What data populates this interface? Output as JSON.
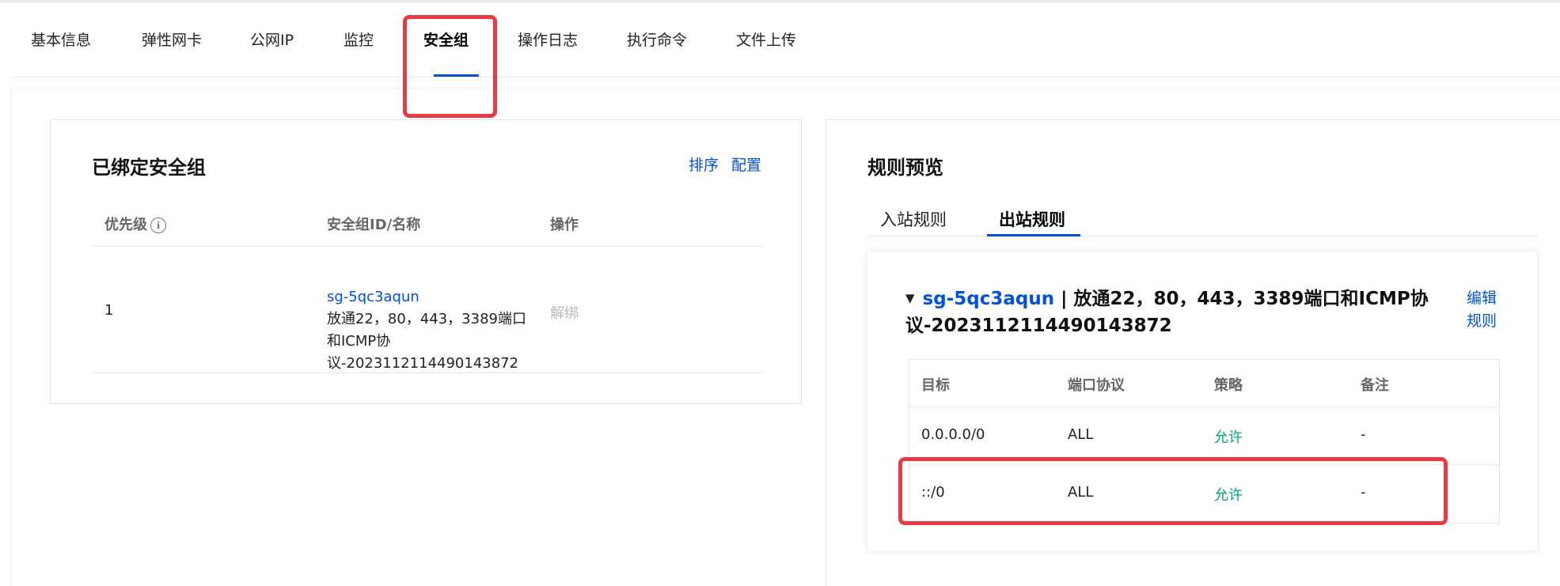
{
  "tabs": [
    {
      "label": "基本信息"
    },
    {
      "label": "弹性网卡"
    },
    {
      "label": "公网IP"
    },
    {
      "label": "监控"
    },
    {
      "label": "安全组"
    },
    {
      "label": "操作日志"
    },
    {
      "label": "执行命令"
    },
    {
      "label": "文件上传"
    }
  ],
  "active_tab": "安全组",
  "bound": {
    "title": "已绑定安全组",
    "actions": {
      "sort": "排序",
      "config": "配置"
    },
    "columns": {
      "priority": "优先级",
      "sg": "安全组ID/名称",
      "op": "操作"
    },
    "rows": [
      {
        "priority": "1",
        "sg_id": "sg-5qc3aqun",
        "sg_name_lines": [
          "放通22，80，443，3389端口",
          "和ICMP协",
          "议-2023112114490143872"
        ],
        "op": "解绑"
      }
    ]
  },
  "preview": {
    "title": "规则预览",
    "tabs": {
      "inbound": "入站规则",
      "outbound": "出站规则"
    },
    "active": "出站规则",
    "group": {
      "sg_id": "sg-5qc3aqun",
      "name": "| 放通22，80，443，3389端口和ICMP协议-2023112114490143872",
      "edit_lines": [
        "编辑",
        "规则"
      ]
    },
    "columns": {
      "target": "目标",
      "port": "端口协议",
      "policy": "策略",
      "remark": "备注"
    },
    "rows": [
      {
        "target": "0.0.0.0/0",
        "port": "ALL",
        "policy": "允许",
        "remark": "-"
      },
      {
        "target": "::/0",
        "port": "ALL",
        "policy": "允许",
        "remark": "-"
      }
    ]
  },
  "colors": {
    "accent": "#0052d9",
    "allow": "#00a870",
    "highlight": "#e63b45"
  }
}
